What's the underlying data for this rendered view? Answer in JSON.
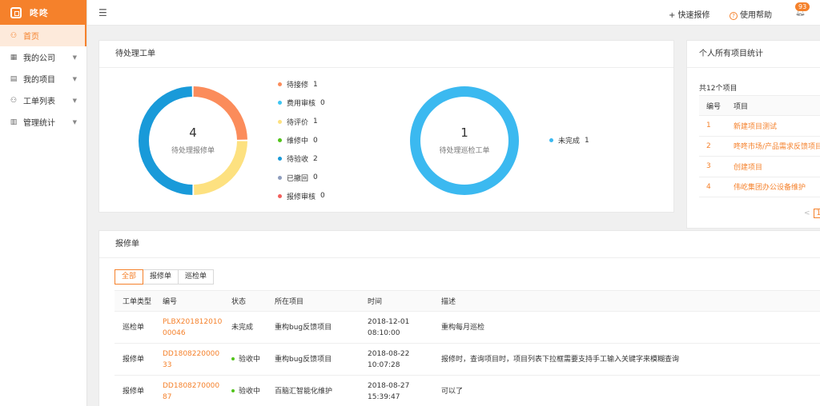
{
  "brand": {
    "name": "咚咚"
  },
  "sidebar": {
    "items": [
      {
        "label": "首页",
        "icon": "user-icon"
      },
      {
        "label": "我的公司",
        "icon": "company-icon"
      },
      {
        "label": "我的项目",
        "icon": "project-icon"
      },
      {
        "label": "工单列表",
        "icon": "user-icon"
      },
      {
        "label": "管理统计",
        "icon": "stats-icon"
      }
    ]
  },
  "topbar": {
    "quick_repair": "+ 快速报修",
    "help": "使用帮助",
    "notifications": "93"
  },
  "pending": {
    "title": "待处理工单",
    "repair_donut": {
      "count": "4",
      "label": "待处理报修单"
    },
    "repair_legend": [
      {
        "name": "待接修",
        "count": "1",
        "color": "#fb8c5b"
      },
      {
        "name": "费用审核",
        "count": "0",
        "color": "#3ec5f2"
      },
      {
        "name": "待评价",
        "count": "1",
        "color": "#fde180"
      },
      {
        "name": "维修中",
        "count": "0",
        "color": "#52c41a"
      },
      {
        "name": "待验收",
        "count": "2",
        "color": "#199ad9"
      },
      {
        "name": "已撤回",
        "count": "0",
        "color": "#8e9dbd"
      },
      {
        "name": "报修审核",
        "count": "0",
        "color": "#f25f5c"
      }
    ],
    "inspect_donut": {
      "count": "1",
      "label": "待处理巡检工单"
    },
    "inspect_legend": [
      {
        "name": "未完成",
        "count": "1",
        "color": "#3bb9f0"
      }
    ]
  },
  "stats": {
    "title": "个人所有项目统计",
    "total": "共12个项目",
    "headers": [
      "编号",
      "项目"
    ],
    "rows": [
      {
        "no": "1",
        "name": "新建项目测试"
      },
      {
        "no": "2",
        "name": "咚咚市场/产品需求反馈项目"
      },
      {
        "no": "3",
        "name": "创建项目"
      },
      {
        "no": "4",
        "name": "伟屹集团办公设备维护"
      }
    ],
    "pager_prev": "<",
    "pager_current": "1"
  },
  "repairs": {
    "title": "报修单",
    "filters": [
      "全部",
      "报修单",
      "巡检单"
    ],
    "headers": [
      "工单类型",
      "编号",
      "状态",
      "所在项目",
      "时间",
      "描述"
    ],
    "rows": [
      {
        "type": "巡检单",
        "code": "PLBX20181201000046",
        "status": "未完成",
        "project": "重构bug反馈项目",
        "time": "2018-12-01 08:10:00",
        "desc": "重构每月巡检"
      },
      {
        "type": "报修单",
        "code": "DD180822000033",
        "status": "验收中",
        "project": "重构bug反馈项目",
        "time": "2018-08-22 10:07:28",
        "desc": "报修时，查询项目时，项目列表下拉框需要支持手工输入关键字来模糊查询"
      },
      {
        "type": "报修单",
        "code": "DD180827000087",
        "status": "验收中",
        "project": "百脑汇智能化维护",
        "time": "2018-08-27 15:39:47",
        "desc": "可以了"
      }
    ]
  }
}
